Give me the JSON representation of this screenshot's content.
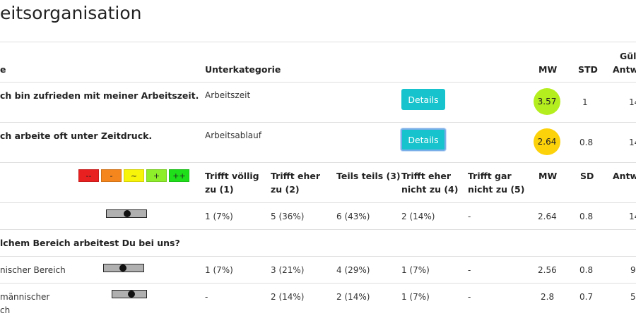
{
  "page": {
    "title": "eitsorganisation"
  },
  "table1": {
    "headers": {
      "frage": "e",
      "unterkategorie": "Unterkategorie",
      "mw": "MW",
      "std": "STD",
      "gueltig_line1": "Gült",
      "gueltig_line2": "Antw"
    },
    "rows": [
      {
        "frage": "ch bin zufrieden mit meiner Arbeitszeit.",
        "unterkategorie": "Arbeitszeit",
        "button": "Details",
        "mw": "3.57",
        "mw_color": "#b5ee1e",
        "std": "1",
        "antworten": "14"
      },
      {
        "frage": "ch arbeite oft unter Zeitdruck.",
        "unterkategorie": "Arbeitsablauf",
        "button": "Details",
        "mw": "2.64",
        "mw_color": "#fcd20a",
        "std": "0.8",
        "antworten": "14"
      }
    ]
  },
  "legend": [
    {
      "label": "--",
      "color": "#e8201f"
    },
    {
      "label": "-",
      "color": "#f5861e"
    },
    {
      "label": "~",
      "color": "#f8f409"
    },
    {
      "label": "+",
      "color": "#8fee2a"
    },
    {
      "label": "++",
      "color": "#1fde1a"
    }
  ],
  "table2": {
    "headers": {
      "c1_line1": "Trifft völlig",
      "c1_line2": "zu (1)",
      "c2_line1": "Trifft eher",
      "c2_line2": "zu (2)",
      "c3": "Teils teils (3)",
      "c4_line1": "Trifft eher",
      "c4_line2": "nicht zu (4)",
      "c5_line1": "Trifft gar",
      "c5_line2": "nicht zu (5)",
      "mw": "MW",
      "sd": "SD",
      "antw": "Antw"
    },
    "total_row": {
      "c1": "1 (7%)",
      "c2": "5 (36%)",
      "c3": "6 (43%)",
      "c4": "2 (14%)",
      "c5": "-",
      "mw": "2.64",
      "sd": "0.8",
      "antw": "14",
      "marker_value": 2.64
    },
    "group_question": "lchem Bereich arbeitest Du bei uns?",
    "groups": [
      {
        "label_line1": "nischer Bereich",
        "label_line2": "",
        "c1": "1 (7%)",
        "c2": "3 (21%)",
        "c3": "4 (29%)",
        "c4": "1 (7%)",
        "c5": "-",
        "mw": "2.56",
        "sd": "0.8",
        "antw": "9",
        "marker_value": 2.56
      },
      {
        "label_line1": "männischer",
        "label_line2": "ch",
        "c1": "-",
        "c2": "2 (14%)",
        "c3": "2 (14%)",
        "c4": "1 (7%)",
        "c5": "-",
        "mw": "2.8",
        "sd": "0.7",
        "antw": "5",
        "marker_value": 2.8
      }
    ]
  }
}
